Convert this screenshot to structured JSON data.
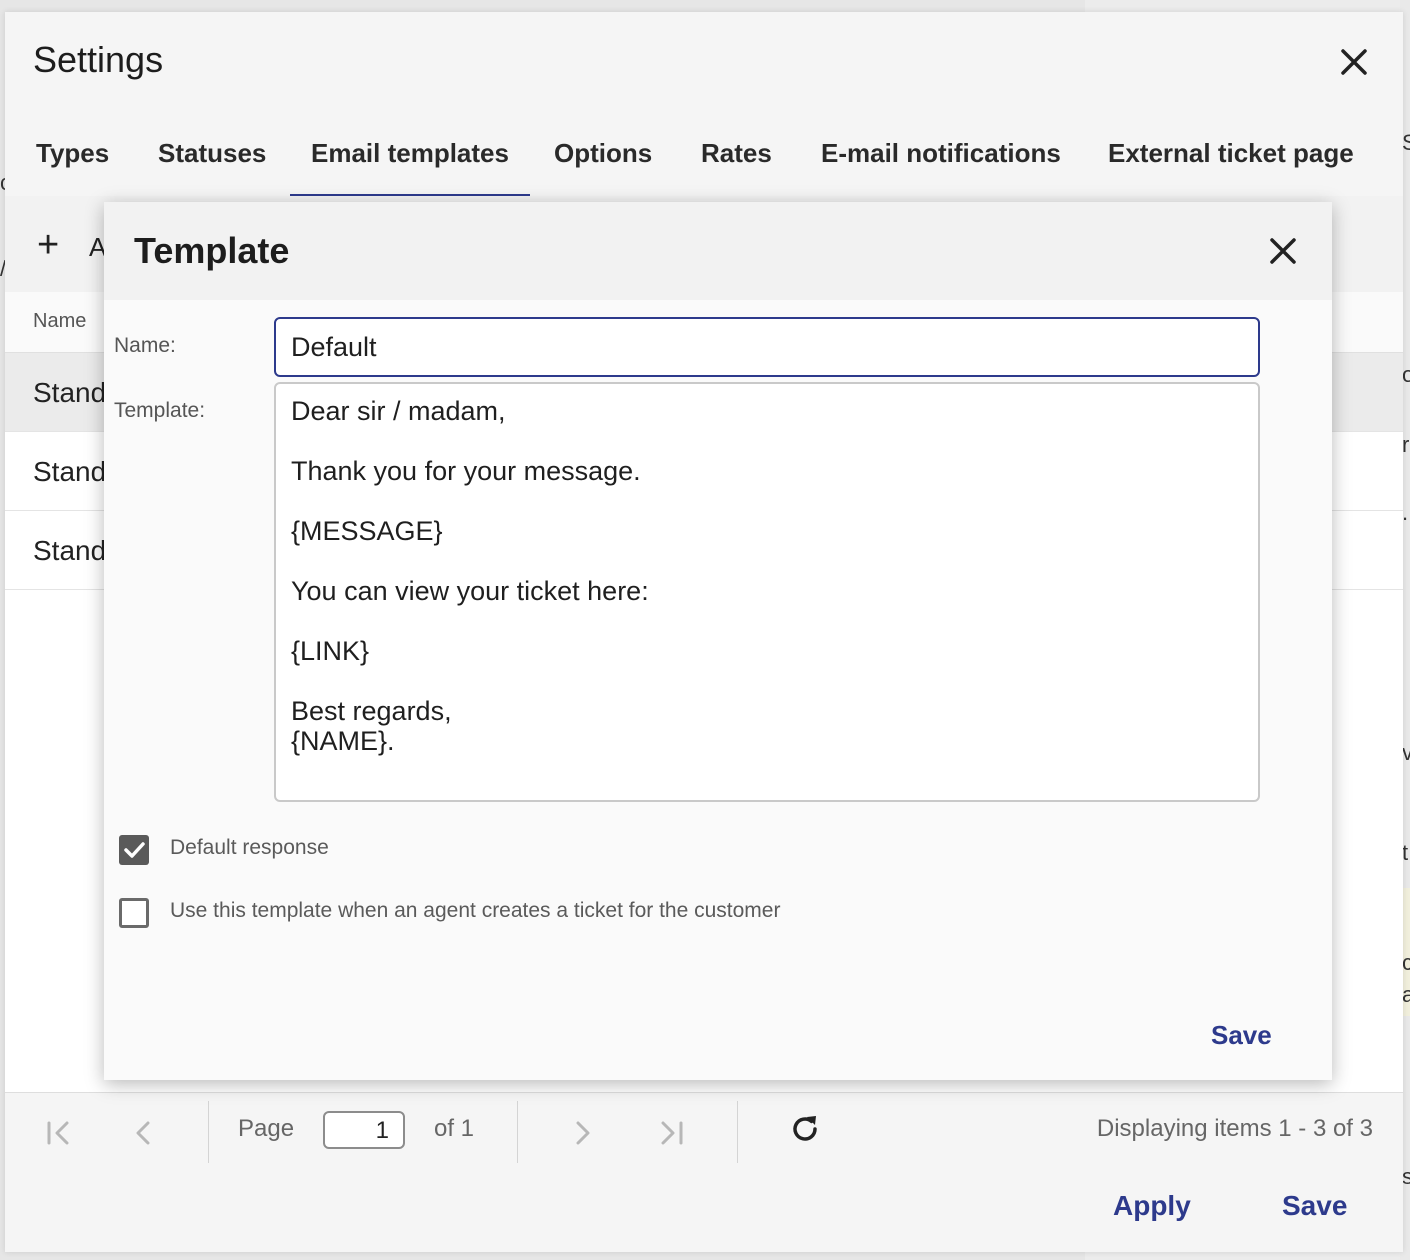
{
  "settings": {
    "title": "Settings",
    "tabs": [
      {
        "label": "Types"
      },
      {
        "label": "Statuses"
      },
      {
        "label": "Email templates",
        "active": true
      },
      {
        "label": "Options"
      },
      {
        "label": "Rates"
      },
      {
        "label": "E-mail notifications"
      },
      {
        "label": "External ticket page"
      }
    ],
    "toolbar": {
      "add_label": "A"
    },
    "grid": {
      "column_header": "Name",
      "rows": [
        {
          "name": "Stand"
        },
        {
          "name": "Stand"
        },
        {
          "name": "Stand"
        }
      ]
    },
    "pager": {
      "page_label": "Page",
      "page_value": "1",
      "of_label": "of 1",
      "display_text": "Displaying items 1 - 3 of 3"
    },
    "footer": {
      "apply_label": "Apply",
      "save_label": "Save"
    }
  },
  "dialog": {
    "title": "Template",
    "name_label": "Name:",
    "name_value": "Default",
    "template_label": "Template:",
    "template_lines": [
      "Dear sir / madam,",
      "",
      "Thank you for your message.",
      "",
      "{MESSAGE}",
      "",
      "You can view your ticket here:",
      "",
      "{LINK}",
      "",
      "Best regards,",
      "{NAME}."
    ],
    "checkbox_default": {
      "label": "Default response",
      "checked": true
    },
    "checkbox_agent": {
      "label": "Use this template when an agent creates a ticket for the customer",
      "checked": false
    },
    "save_label": "Save"
  },
  "background": {
    "fragments": [
      "c",
      "/",
      "S",
      "o",
      "r",
      ".",
      "v",
      "t",
      "c",
      "a",
      "s"
    ]
  },
  "colors": {
    "accent": "#2d3a8c",
    "dialog_bg": "#fafafa",
    "header_bg": "#f2f2f2"
  },
  "icons": {
    "close": "close-icon",
    "add": "plus-icon",
    "first": "first-page-icon",
    "prev": "prev-page-icon",
    "next": "next-page-icon",
    "last": "last-page-icon",
    "refresh": "refresh-icon",
    "check": "checkmark-icon"
  }
}
